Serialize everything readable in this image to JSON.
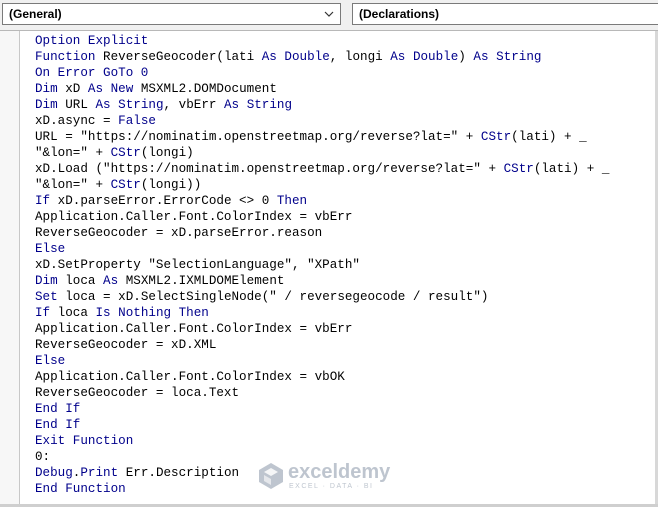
{
  "toolbar": {
    "object_combo_value": "(General)",
    "procedure_combo_value": "(Declarations)"
  },
  "code": {
    "keyword_color": "#00008b",
    "text_color": "#000000",
    "lines": [
      [
        {
          "t": "Option Explicit",
          "k": true
        }
      ],
      [
        {
          "t": "Function",
          "k": true
        },
        {
          "t": " ReverseGeocoder(lati "
        },
        {
          "t": "As",
          "k": true
        },
        {
          "t": " "
        },
        {
          "t": "Double",
          "k": true
        },
        {
          "t": ", longi "
        },
        {
          "t": "As",
          "k": true
        },
        {
          "t": " "
        },
        {
          "t": "Double",
          "k": true
        },
        {
          "t": ") "
        },
        {
          "t": "As",
          "k": true
        },
        {
          "t": " "
        },
        {
          "t": "String",
          "k": true
        }
      ],
      [
        {
          "t": "On Error GoTo 0",
          "k": true
        }
      ],
      [
        {
          "t": "Dim",
          "k": true
        },
        {
          "t": " xD "
        },
        {
          "t": "As New",
          "k": true
        },
        {
          "t": " MSXML2.DOMDocument"
        }
      ],
      [
        {
          "t": "Dim",
          "k": true
        },
        {
          "t": " URL "
        },
        {
          "t": "As",
          "k": true
        },
        {
          "t": " "
        },
        {
          "t": "String",
          "k": true
        },
        {
          "t": ", vbErr "
        },
        {
          "t": "As",
          "k": true
        },
        {
          "t": " "
        },
        {
          "t": "String",
          "k": true
        }
      ],
      [
        {
          "t": "xD.async = "
        },
        {
          "t": "False",
          "k": true
        }
      ],
      [
        {
          "t": "URL = \"https://nominatim.openstreetmap.org/reverse?lat=\" + "
        },
        {
          "t": "CStr",
          "k": true
        },
        {
          "t": "(lati) + _"
        }
      ],
      [
        {
          "t": "\"&lon=\" + "
        },
        {
          "t": "CStr",
          "k": true
        },
        {
          "t": "(longi)"
        }
      ],
      [
        {
          "t": "xD.Load (\"https://nominatim.openstreetmap.org/reverse?lat=\" + "
        },
        {
          "t": "CStr",
          "k": true
        },
        {
          "t": "(lati) + _"
        }
      ],
      [
        {
          "t": "\"&lon=\" + "
        },
        {
          "t": "CStr",
          "k": true
        },
        {
          "t": "(longi))"
        }
      ],
      [
        {
          "t": "If",
          "k": true
        },
        {
          "t": " xD.parseError.ErrorCode <> 0 "
        },
        {
          "t": "Then",
          "k": true
        }
      ],
      [
        {
          "t": "Application.Caller.Font.ColorIndex = vbErr"
        }
      ],
      [
        {
          "t": "ReverseGeocoder = xD.parseError.reason"
        }
      ],
      [
        {
          "t": "Else",
          "k": true
        }
      ],
      [
        {
          "t": "xD.SetProperty \"SelectionLanguage\", \"XPath\""
        }
      ],
      [
        {
          "t": "Dim",
          "k": true
        },
        {
          "t": " loca "
        },
        {
          "t": "As",
          "k": true
        },
        {
          "t": " MSXML2.IXMLDOMElement"
        }
      ],
      [
        {
          "t": "Set",
          "k": true
        },
        {
          "t": " loca = xD.SelectSingleNode(\" / reversegeocode / result\")"
        }
      ],
      [
        {
          "t": "If",
          "k": true
        },
        {
          "t": " loca "
        },
        {
          "t": "Is Nothing Then",
          "k": true
        }
      ],
      [
        {
          "t": "Application.Caller.Font.ColorIndex = vbErr"
        }
      ],
      [
        {
          "t": "ReverseGeocoder = xD.XML"
        }
      ],
      [
        {
          "t": "Else",
          "k": true
        }
      ],
      [
        {
          "t": "Application.Caller.Font.ColorIndex = vbOK"
        }
      ],
      [
        {
          "t": "ReverseGeocoder = loca.Text"
        }
      ],
      [
        {
          "t": "End If",
          "k": true
        }
      ],
      [
        {
          "t": "End If",
          "k": true
        }
      ],
      [
        {
          "t": "Exit Function",
          "k": true
        }
      ],
      [
        {
          "t": "0:"
        }
      ],
      [
        {
          "t": "Debug",
          "k": true
        },
        {
          "t": "."
        },
        {
          "t": "Print",
          "k": true
        },
        {
          "t": " Err.Description"
        }
      ],
      [
        {
          "t": "End Function",
          "k": true
        }
      ]
    ]
  },
  "watermark": {
    "name": "exceldemy",
    "tagline": "EXCEL · DATA · BI",
    "color": "#8a97a8"
  }
}
